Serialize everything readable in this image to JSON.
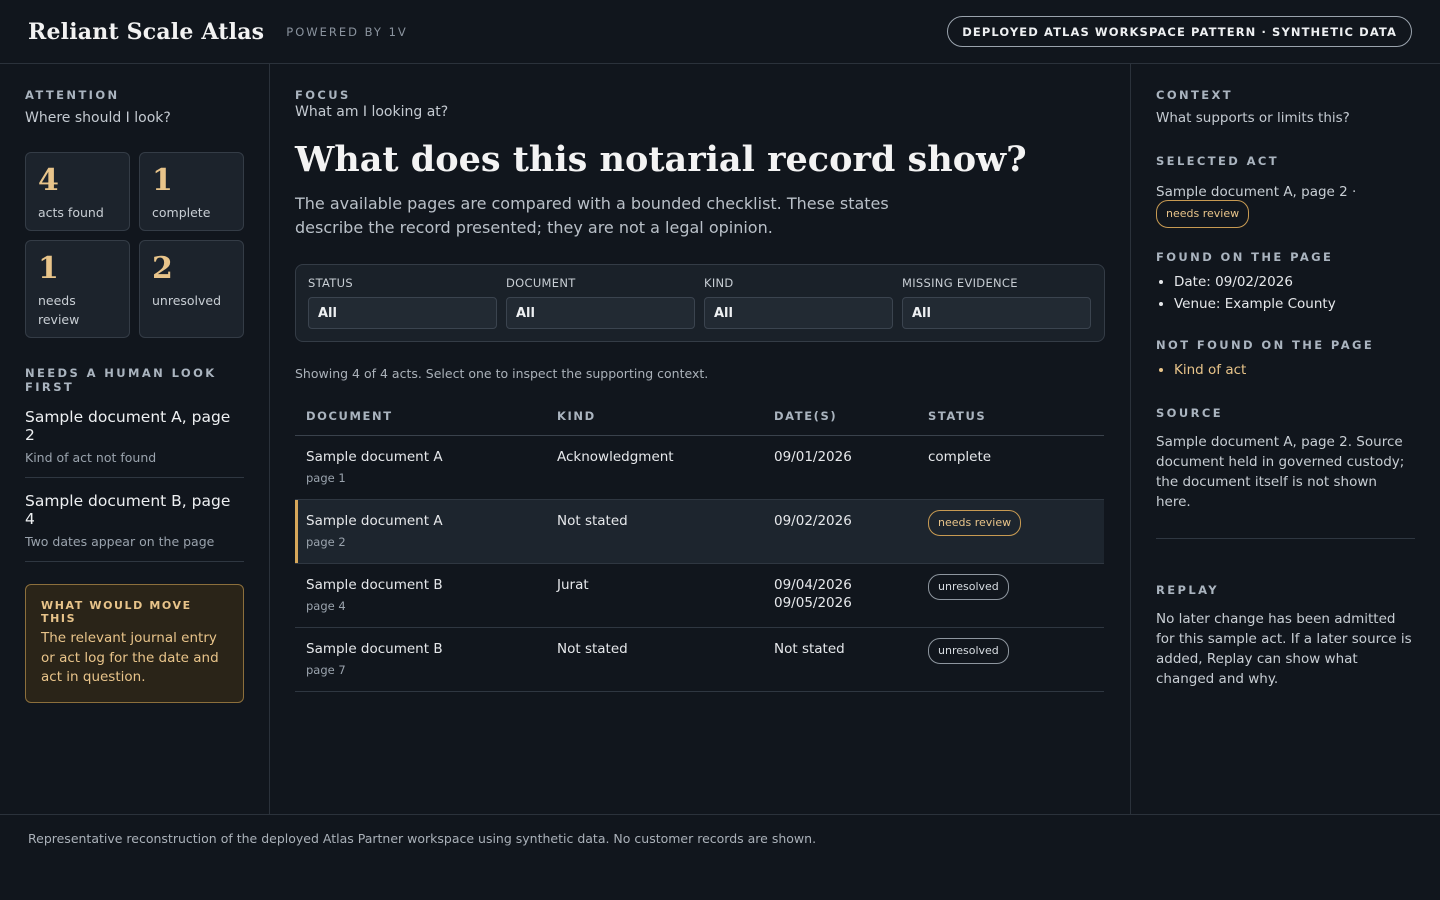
{
  "header": {
    "brand": "Reliant Scale Atlas",
    "powered": "POWERED BY 1V",
    "pill": "DEPLOYED ATLAS WORKSPACE PATTERN · SYNTHETIC DATA"
  },
  "attention": {
    "eyebrow": "ATTENTION",
    "question": "Where should I look?",
    "stats": [
      {
        "value": "4",
        "label": "acts found"
      },
      {
        "value": "1",
        "label": "complete"
      },
      {
        "value": "1",
        "label": "needs review"
      },
      {
        "value": "2",
        "label": "unresolved"
      }
    ],
    "human_title": "NEEDS A HUMAN LOOK FIRST",
    "human_items": [
      {
        "title": "Sample document A, page 2",
        "sub": "Kind of act not found"
      },
      {
        "title": "Sample document B, page 4",
        "sub": "Two dates appear on the page"
      }
    ],
    "move_title": "WHAT WOULD MOVE THIS",
    "move_body": "The relevant journal entry or act log for the date and act in question."
  },
  "focus": {
    "eyebrow": "FOCUS",
    "question": "What am I looking at?",
    "headline": "What does this notarial record show?",
    "lede": "The available pages are compared with a bounded checklist. These states describe the record presented; they are not a legal opinion.",
    "filters": [
      {
        "label": "STATUS",
        "value": "All"
      },
      {
        "label": "DOCUMENT",
        "value": "All"
      },
      {
        "label": "KIND",
        "value": "All"
      },
      {
        "label": "MISSING EVIDENCE",
        "value": "All"
      }
    ],
    "showing": "Showing 4 of 4 acts. Select one to inspect the supporting context.",
    "columns": [
      "DOCUMENT",
      "KIND",
      "DATE(S)",
      "STATUS"
    ],
    "rows": [
      {
        "doc": "Sample document A",
        "page": "page 1",
        "kind": "Acknowledgment",
        "date1": "09/01/2026",
        "date2": "",
        "status": "complete"
      },
      {
        "doc": "Sample document A",
        "page": "page 2",
        "kind": "Not stated",
        "date1": "09/02/2026",
        "date2": "",
        "status": "needs review"
      },
      {
        "doc": "Sample document B",
        "page": "page 4",
        "kind": "Jurat",
        "date1": "09/04/2026",
        "date2": "09/05/2026",
        "status": "unresolved"
      },
      {
        "doc": "Sample document B",
        "page": "page 7",
        "kind": "Not stated",
        "date1": "Not stated",
        "date2": "",
        "status": "unresolved"
      }
    ]
  },
  "context": {
    "eyebrow": "CONTEXT",
    "question": "What supports or limits this?",
    "selected_title": "SELECTED ACT",
    "selected_text": "Sample document A, page 2 ·",
    "selected_badge": "needs review",
    "found_title": "FOUND ON THE PAGE",
    "found": [
      "Date: 09/02/2026",
      "Venue: Example County"
    ],
    "notfound_title": "NOT FOUND ON THE PAGE",
    "notfound": [
      "Kind of act"
    ],
    "source_title": "SOURCE",
    "source_body": "Sample document A, page 2. Source document held in governed custody; the document itself is not shown here.",
    "replay_title": "REPLAY",
    "replay_body": "No later change has been admitted for this sample act. If a later source is added, Replay can show what changed and why."
  },
  "footer": {
    "text": "Representative reconstruction of the deployed Atlas Partner workspace using synthetic data. No customer records are shown."
  }
}
